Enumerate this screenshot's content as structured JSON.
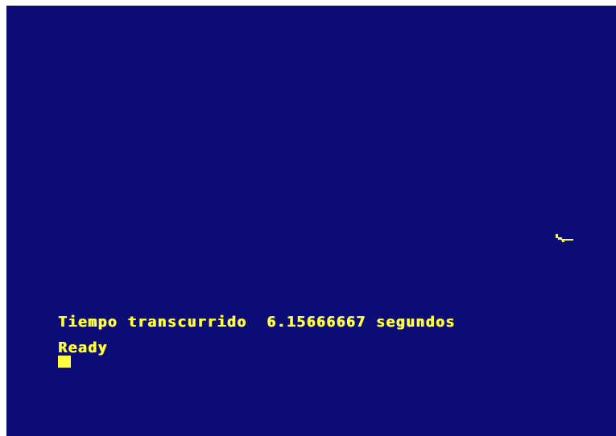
{
  "screen": {
    "background_color": "#0b0c75",
    "text_color": "#ffff40"
  },
  "console": {
    "elapsed_label": "Tiempo transcurrido",
    "elapsed_value": "6.15666667",
    "elapsed_unit": "segundos",
    "ready_prompt": "Ready"
  },
  "icons": {
    "sprite": "small-yellow-sprite-icon",
    "cursor": "block-cursor"
  }
}
